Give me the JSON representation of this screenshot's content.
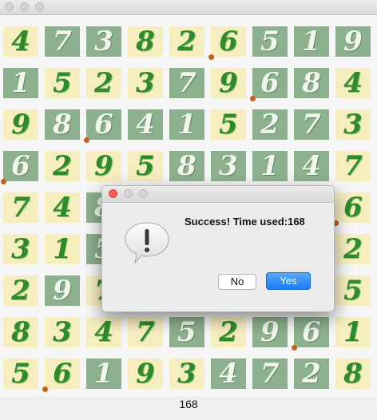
{
  "window": {
    "traffic_lights": [
      "close-button",
      "minimize-button",
      "zoom-button"
    ]
  },
  "board": {
    "rows": [
      [
        {
          "d": "4",
          "c": "y"
        },
        {
          "d": "7",
          "c": "g"
        },
        {
          "d": "3",
          "c": "g"
        },
        {
          "d": "8",
          "c": "y"
        },
        {
          "d": "2",
          "c": "y"
        },
        {
          "d": "6",
          "c": "y"
        },
        {
          "d": "5",
          "c": "g"
        },
        {
          "d": "1",
          "c": "g"
        },
        {
          "d": "9",
          "c": "g"
        }
      ],
      [
        {
          "d": "1",
          "c": "g"
        },
        {
          "d": "5",
          "c": "y"
        },
        {
          "d": "2",
          "c": "y"
        },
        {
          "d": "3",
          "c": "y"
        },
        {
          "d": "7",
          "c": "g"
        },
        {
          "d": "9",
          "c": "y"
        },
        {
          "d": "6",
          "c": "g"
        },
        {
          "d": "8",
          "c": "g"
        },
        {
          "d": "4",
          "c": "y"
        }
      ],
      [
        {
          "d": "9",
          "c": "y"
        },
        {
          "d": "8",
          "c": "g"
        },
        {
          "d": "6",
          "c": "g"
        },
        {
          "d": "4",
          "c": "g"
        },
        {
          "d": "1",
          "c": "g"
        },
        {
          "d": "5",
          "c": "y"
        },
        {
          "d": "2",
          "c": "g"
        },
        {
          "d": "7",
          "c": "g"
        },
        {
          "d": "3",
          "c": "y"
        }
      ],
      [
        {
          "d": "6",
          "c": "g"
        },
        {
          "d": "2",
          "c": "y"
        },
        {
          "d": "9",
          "c": "y"
        },
        {
          "d": "5",
          "c": "y"
        },
        {
          "d": "8",
          "c": "g"
        },
        {
          "d": "3",
          "c": "g"
        },
        {
          "d": "1",
          "c": "g"
        },
        {
          "d": "4",
          "c": "g"
        },
        {
          "d": "7",
          "c": "y"
        }
      ],
      [
        {
          "d": "7",
          "c": "y"
        },
        {
          "d": "4",
          "c": "y"
        },
        {
          "d": "8",
          "c": "g"
        },
        {
          "d": "",
          "c": "y"
        },
        {
          "d": "",
          "c": "y"
        },
        {
          "d": "",
          "c": "y"
        },
        {
          "d": "",
          "c": "y"
        },
        {
          "d": "",
          "c": "y"
        },
        {
          "d": "6",
          "c": "y"
        }
      ],
      [
        {
          "d": "3",
          "c": "y"
        },
        {
          "d": "1",
          "c": "y"
        },
        {
          "d": "5",
          "c": "g"
        },
        {
          "d": "",
          "c": "y"
        },
        {
          "d": "",
          "c": "y"
        },
        {
          "d": "",
          "c": "y"
        },
        {
          "d": "",
          "c": "y"
        },
        {
          "d": "",
          "c": "y"
        },
        {
          "d": "2",
          "c": "y"
        }
      ],
      [
        {
          "d": "2",
          "c": "y"
        },
        {
          "d": "9",
          "c": "g"
        },
        {
          "d": "7",
          "c": "y"
        },
        {
          "d": "",
          "c": "y"
        },
        {
          "d": "",
          "c": "y"
        },
        {
          "d": "",
          "c": "y"
        },
        {
          "d": "",
          "c": "y"
        },
        {
          "d": "",
          "c": "y"
        },
        {
          "d": "5",
          "c": "y"
        }
      ],
      [
        {
          "d": "8",
          "c": "y"
        },
        {
          "d": "3",
          "c": "y"
        },
        {
          "d": "4",
          "c": "y"
        },
        {
          "d": "7",
          "c": "y"
        },
        {
          "d": "5",
          "c": "g"
        },
        {
          "d": "2",
          "c": "y"
        },
        {
          "d": "9",
          "c": "g"
        },
        {
          "d": "6",
          "c": "g"
        },
        {
          "d": "1",
          "c": "y"
        }
      ],
      [
        {
          "d": "5",
          "c": "y"
        },
        {
          "d": "6",
          "c": "y"
        },
        {
          "d": "1",
          "c": "g"
        },
        {
          "d": "9",
          "c": "y"
        },
        {
          "d": "3",
          "c": "y"
        },
        {
          "d": "4",
          "c": "g"
        },
        {
          "d": "7",
          "c": "g"
        },
        {
          "d": "2",
          "c": "g"
        },
        {
          "d": "8",
          "c": "y"
        }
      ]
    ]
  },
  "status_text": "168",
  "dialog": {
    "icon": "alert-exclamation-icon",
    "message": "Success! Time used:168",
    "no_label": "No",
    "yes_label": "Yes"
  },
  "colors": {
    "tile_yellow": "#f7eec0",
    "tile_green": "#8db08e",
    "digit_green": "#2f8a2c",
    "marker": "#c2621e",
    "accent_blue": "#1c7cf5"
  }
}
